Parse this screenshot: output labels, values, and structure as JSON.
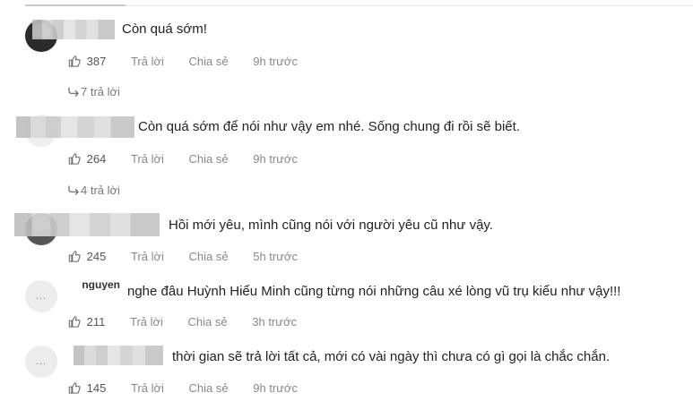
{
  "comments": [
    {
      "text": "Còn quá sớm!",
      "likes": "387",
      "reply_label": "Trả lời",
      "share_label": "Chia sẻ",
      "time": "9h trước",
      "replies_label": "7 trả lời"
    },
    {
      "text": "Còn quá sớm để nói như vậy em nhé. Sống chung đi rồi sẽ biết.",
      "likes": "264",
      "reply_label": "Trả lời",
      "share_label": "Chia sẻ",
      "time": "9h trước",
      "replies_label": "4 trả lời"
    },
    {
      "text": "Hồi mới yêu, mình cũng nói với người yêu cũ như vậy.",
      "likes": "245",
      "reply_label": "Trả lời",
      "share_label": "Chia sẻ",
      "time": "5h trước"
    },
    {
      "name": "nguyen",
      "avatar_text": "...",
      "text": "nghe đâu Huỳnh Hiểu Minh cũng từng nói những câu xé lòng vũ trụ kiểu như vậy!!!",
      "likes": "211",
      "reply_label": "Trả lời",
      "share_label": "Chia sẻ",
      "time": "3h trước"
    },
    {
      "avatar_text": "...",
      "text": "thời gian sẽ trả lời tất cả, mới có vài ngày thì chưa có gì gọi là chắc chắn.",
      "likes": "145",
      "reply_label": "Trả lời",
      "share_label": "Chia sẻ",
      "time": "9h trước"
    }
  ],
  "icons": {
    "like": "thumbs-up-icon",
    "reply_arrow": "reply-arrow-icon"
  }
}
